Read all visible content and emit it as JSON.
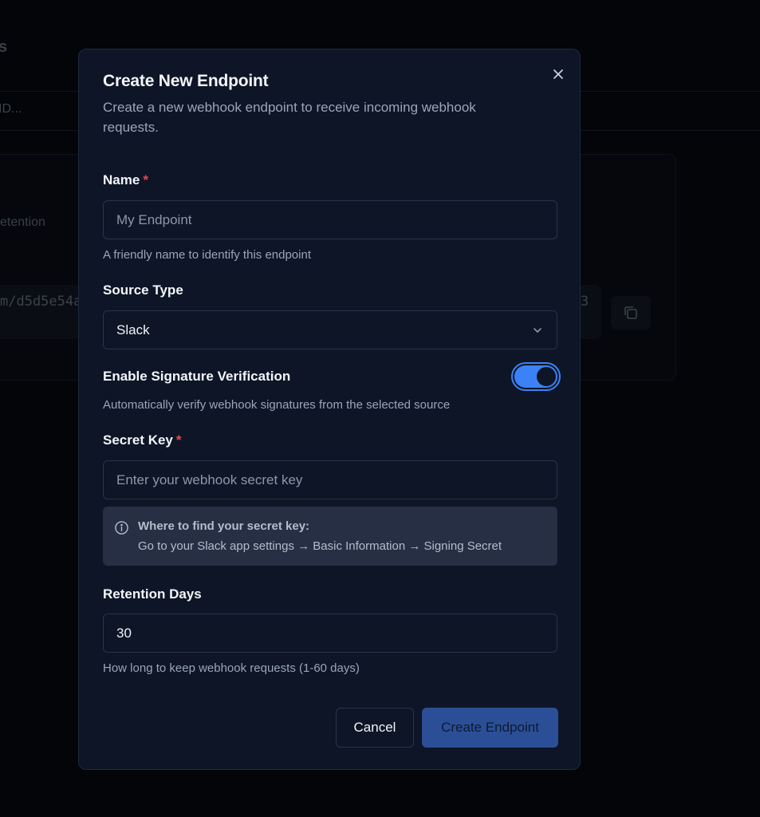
{
  "background": {
    "title_fragment": "s",
    "search_fragment": "ID...",
    "retention_fragment": "etention",
    "url_fragment": "m/d5d5e54a",
    "url_tail_fragment": "3"
  },
  "modal": {
    "title": "Create New Endpoint",
    "description": "Create a new webhook endpoint to receive incoming webhook requests.",
    "name": {
      "label": "Name",
      "required_mark": "*",
      "placeholder": "My Endpoint",
      "value": "",
      "help": "A friendly name to identify this endpoint"
    },
    "source_type": {
      "label": "Source Type",
      "selected": "Slack"
    },
    "signature": {
      "label": "Enable Signature Verification",
      "enabled": true,
      "help": "Automatically verify webhook signatures from the selected source"
    },
    "secret_key": {
      "label": "Secret Key",
      "required_mark": "*",
      "placeholder": "Enter your webhook secret key",
      "value": ""
    },
    "info": {
      "title": "Where to find your secret key:",
      "text": "Go to your Slack app settings → Basic Information → Signing Secret"
    },
    "retention": {
      "label": "Retention Days",
      "value": "30",
      "help": "How long to keep webhook requests (1-60 days)"
    },
    "buttons": {
      "cancel": "Cancel",
      "create": "Create Endpoint"
    }
  },
  "colors": {
    "modal_bg": "#0d1527",
    "accent": "#3b82f6",
    "required": "#ef4444",
    "create_button_bg": "#2b4f96"
  },
  "icons": {
    "close": "close-icon",
    "chevron": "chevron-down-icon",
    "info": "info-icon",
    "copy": "copy-icon"
  }
}
